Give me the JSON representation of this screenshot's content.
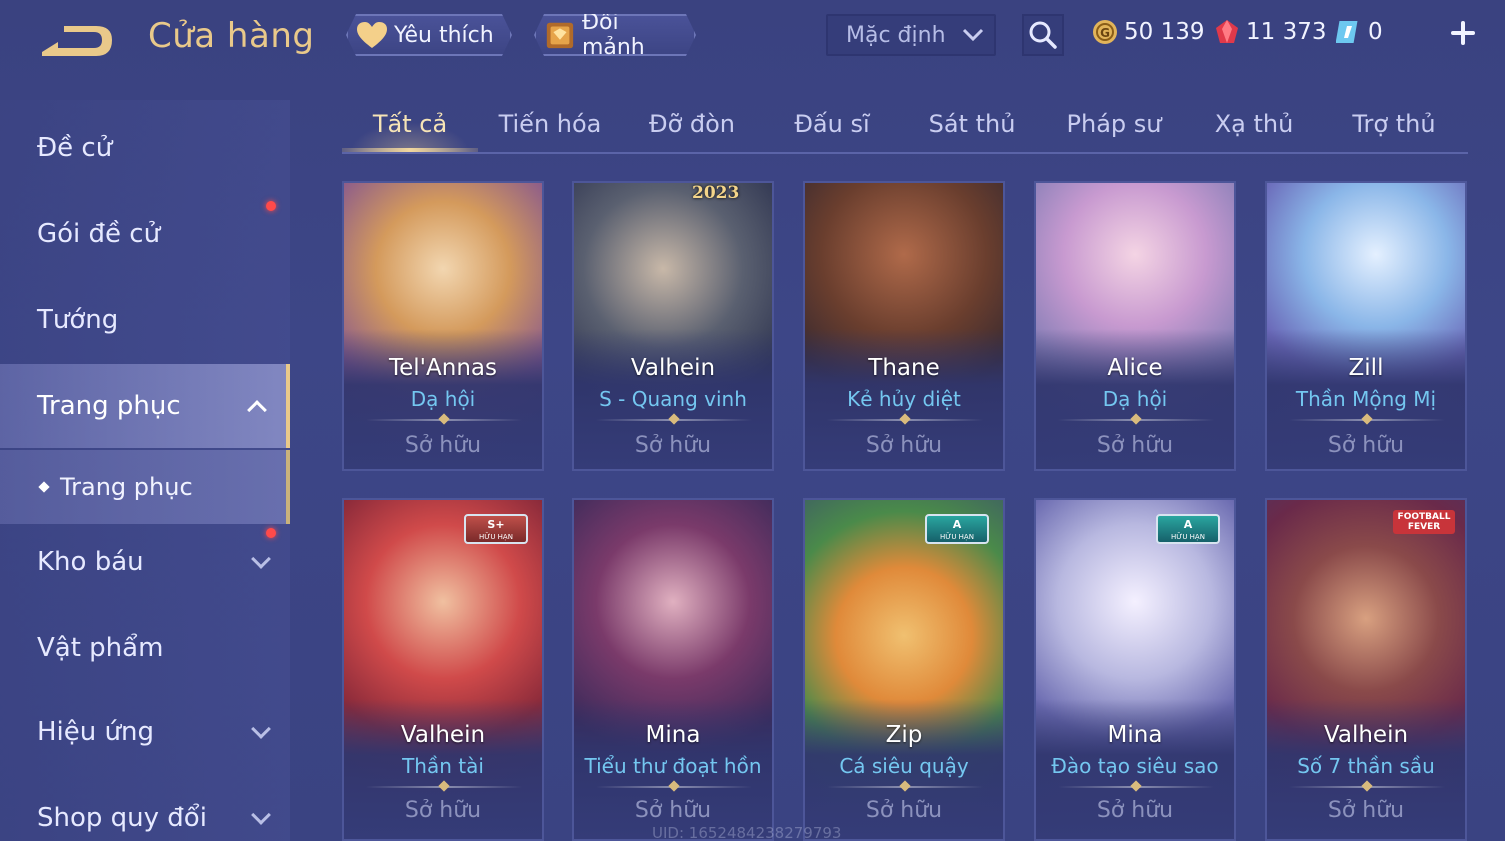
{
  "header": {
    "title": "Cửa hàng",
    "favorite_label": "Yêu thích",
    "exchange_label": "Đổi mảnh",
    "sort_value": "Mặc định",
    "gold": "50 139",
    "ruby": "11 373",
    "voucher": "0"
  },
  "sidebar": {
    "items": [
      {
        "label": "Đề cử"
      },
      {
        "label": "Gói đề cử"
      },
      {
        "label": "Tướng"
      },
      {
        "label": "Trang phục"
      },
      {
        "label": "Trang phục"
      },
      {
        "label": "Kho báu"
      },
      {
        "label": "Vật phẩm"
      },
      {
        "label": "Hiệu ứng"
      },
      {
        "label": "Shop quy đổi"
      }
    ]
  },
  "tabs": [
    "Tất cả",
    "Tiến hóa",
    "Đỡ đòn",
    "Đấu sĩ",
    "Sát thủ",
    "Pháp sư",
    "Xạ thủ",
    "Trợ thủ"
  ],
  "cards": [
    {
      "hero": "Tel'Annas",
      "skin": "Dạ hội",
      "status": "Sở hữu"
    },
    {
      "hero": "Valhein",
      "skin": "S - Quang vinh",
      "status": "Sở hữu",
      "tag": "2023"
    },
    {
      "hero": "Thane",
      "skin": "Kẻ hủy diệt",
      "status": "Sở hữu"
    },
    {
      "hero": "Alice",
      "skin": "Dạ hội",
      "status": "Sở hữu"
    },
    {
      "hero": "Zill",
      "skin": "Thần Mộng Mị",
      "status": "Sở hữu"
    },
    {
      "hero": "Valhein",
      "skin": "Thần tài",
      "status": "Sở hữu",
      "badge": "S+",
      "badge_sub": "HỮU HẠN"
    },
    {
      "hero": "Mina",
      "skin": "Tiểu thư đoạt hồn",
      "status": "Sở hữu"
    },
    {
      "hero": "Zip",
      "skin": "Cá siêu quậy",
      "status": "Sở hữu",
      "badge": "A",
      "badge_sub": "HỮU HẠN"
    },
    {
      "hero": "Mina",
      "skin": "Đào tạo siêu sao",
      "status": "Sở hữu",
      "badge": "A",
      "badge_sub": "HỮU HẠN"
    },
    {
      "hero": "Valhein",
      "skin": "Số 7 thần sầu",
      "status": "Sở hữu",
      "tag": "FOOTBALL FEVER"
    }
  ],
  "watermark": "UID: 1652484238279793",
  "colors": {
    "accent_gold": "#e9c98a",
    "skin_name": "#74c7f0",
    "notification": "#ff4a4a"
  }
}
